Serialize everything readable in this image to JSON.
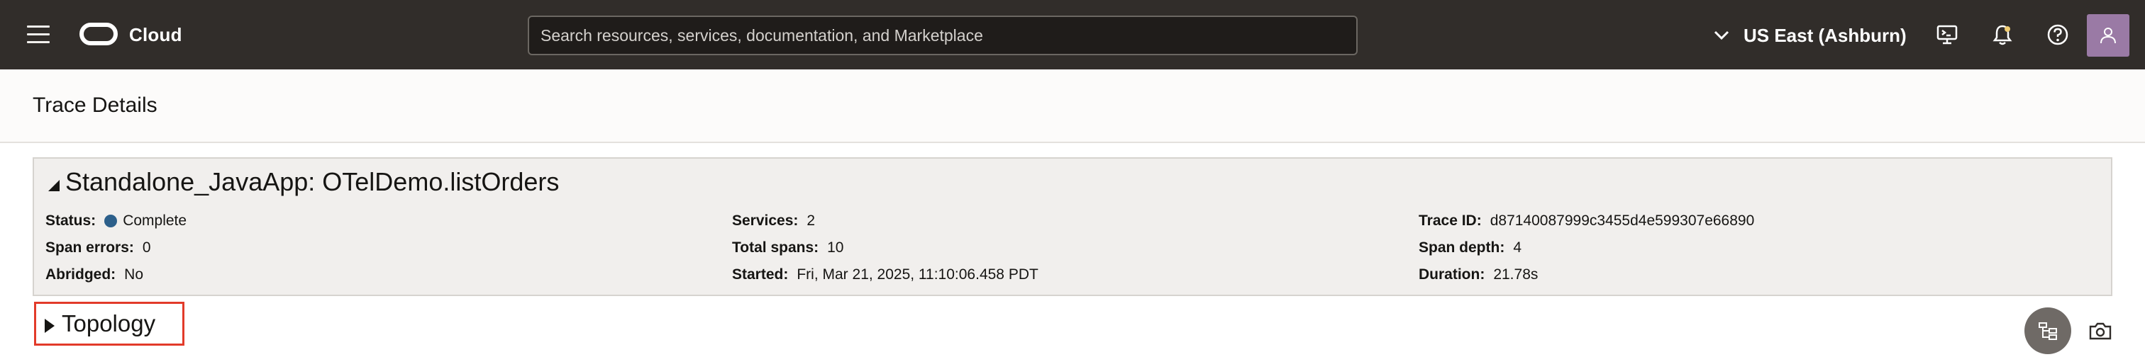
{
  "header": {
    "brand": "Cloud",
    "search_placeholder": "Search resources, services, documentation, and Marketplace",
    "region": "US East (Ashburn)",
    "icons": [
      "menu-icon",
      "oracle-logo",
      "chevron-down-icon",
      "cloud-shell-icon",
      "bell-icon",
      "help-icon",
      "profile-icon"
    ]
  },
  "page": {
    "title": "Trace Details"
  },
  "trace": {
    "name": "Standalone_JavaApp: OTelDemo.listOrders",
    "status_label": "Status:",
    "status_value": "Complete",
    "status_color": "#2c5f8a",
    "span_errors_label": "Span errors:",
    "span_errors_value": "0",
    "abridged_label": "Abridged:",
    "abridged_value": "No",
    "services_label": "Services:",
    "services_value": "2",
    "total_spans_label": "Total spans:",
    "total_spans_value": "10",
    "started_label": "Started:",
    "started_value": "Fri, Mar 21, 2025, 11:10:06.458 PDT",
    "trace_id_label": "Trace ID:",
    "trace_id_value": "d87140087999c3455d4e599307e66890",
    "span_depth_label": "Span depth:",
    "span_depth_value": "4",
    "duration_label": "Duration:",
    "duration_value": "21.78s"
  },
  "topology": {
    "label": "Topology",
    "highlight_color": "#e23b2a"
  }
}
